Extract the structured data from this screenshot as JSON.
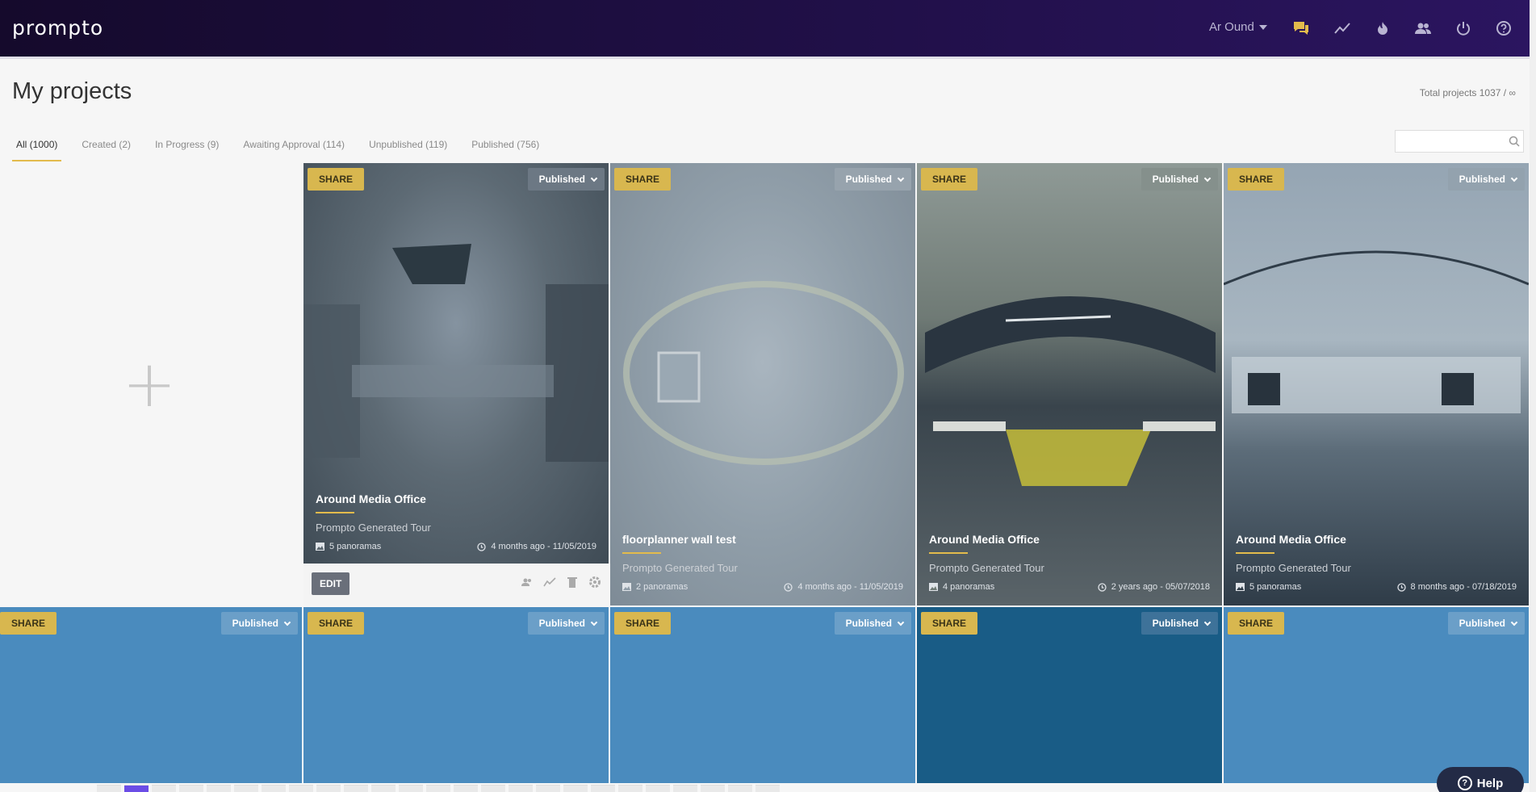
{
  "header": {
    "logo": "prompto",
    "user": "Ar Ound",
    "icons": [
      "chat-icon",
      "analytics-icon",
      "flame-icon",
      "users-icon",
      "power-icon",
      "help-circle-icon"
    ]
  },
  "page": {
    "title": "My projects",
    "total": "Total projects 1037 / ∞"
  },
  "tabs": [
    {
      "label": "All (1000)",
      "active": true
    },
    {
      "label": "Created (2)"
    },
    {
      "label": "In Progress (9)"
    },
    {
      "label": "Awaiting Approval (114)"
    },
    {
      "label": "Unpublished (119)"
    },
    {
      "label": "Published (756)"
    }
  ],
  "search": {
    "placeholder": ""
  },
  "add_tile": {
    "label": "+"
  },
  "labels": {
    "share": "SHARE",
    "status": "Published",
    "edit": "EDIT",
    "help": "Help"
  },
  "cards_row1": [
    {
      "title": "Around Media Office",
      "subtitle": "Prompto Generated Tour",
      "panoramas": "5 panoramas",
      "date": "4 months ago - 11/05/2019",
      "color": "#59656e"
    },
    {
      "title": "floorplanner wall test",
      "subtitle": "Prompto Generated Tour",
      "panoramas": "2 panoramas",
      "date": "4 months ago - 11/05/2019",
      "color": "#8f9ca7"
    },
    {
      "title": "Around Media Office",
      "subtitle": "Prompto Generated Tour",
      "panoramas": "4 panoramas",
      "date": "2 years ago - 05/07/2018",
      "color": "#6f7a75"
    },
    {
      "title": "Around Media Office",
      "subtitle": "Prompto Generated Tour",
      "panoramas": "5 panoramas",
      "date": "8 months ago - 07/18/2019",
      "color": "#7d8e9c"
    }
  ],
  "cards_row2_colors": [
    "#4a8bbe",
    "#4a8bbe",
    "#4a8bbe",
    "#195c86",
    "#4a8bbe"
  ],
  "colors": {
    "accent": "#e3bb4c",
    "share": "#d8b74f",
    "header": "#1f0f45"
  }
}
